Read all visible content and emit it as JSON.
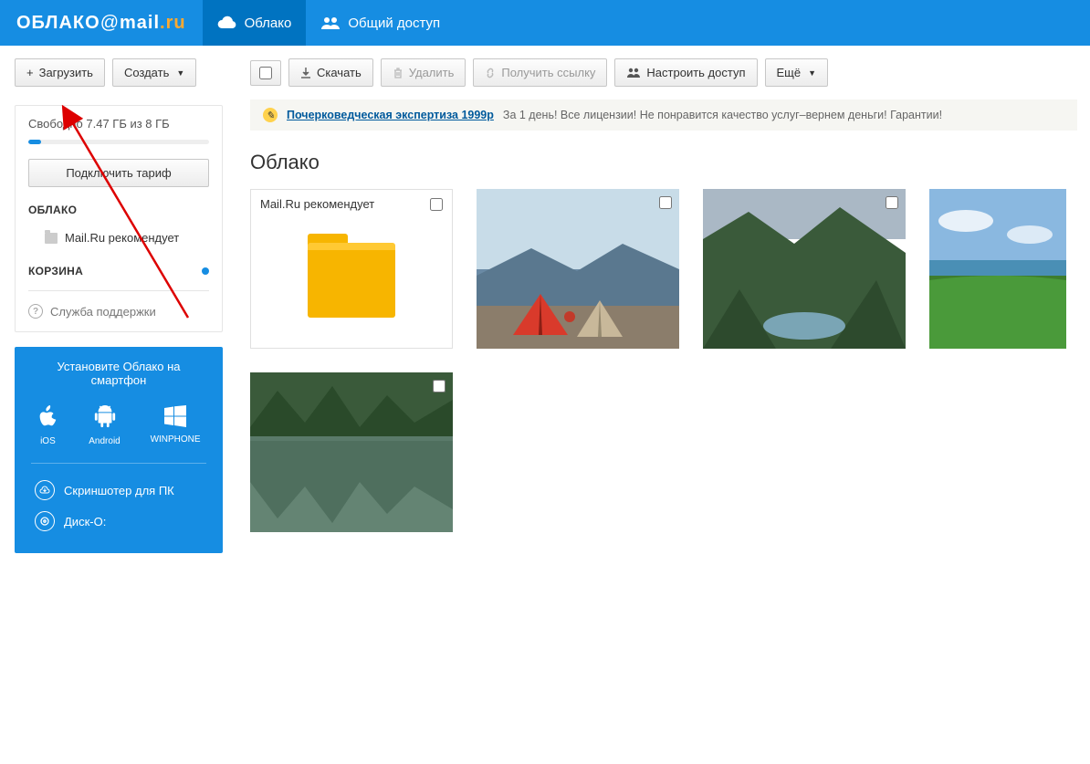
{
  "header": {
    "logo_pre": "ОБЛАКО",
    "logo_at": "@",
    "logo_brand1": "mail",
    "logo_brand2": ".ru",
    "nav": [
      {
        "label": "Облако",
        "active": true
      },
      {
        "label": "Общий доступ",
        "active": false
      }
    ]
  },
  "sidebar": {
    "upload_btn": "Загрузить",
    "create_btn": "Создать",
    "storage_text": "Свободно 7.47 ГБ из 8 ГБ",
    "plan_btn": "Подключить тариф",
    "section_cloud": "ОБЛАКО",
    "cloud_items": [
      {
        "label": "Mail.Ru рекомендует"
      }
    ],
    "section_trash": "КОРЗИНА",
    "support": "Служба поддержки"
  },
  "promo": {
    "title": "Установите Облако на смартфон",
    "apps": [
      {
        "label": "iOS"
      },
      {
        "label": "Android"
      },
      {
        "label": "WINPHONE"
      }
    ],
    "line1": "Скриншотер для ПК",
    "line2": "Диск-О:"
  },
  "toolbar": {
    "download": "Скачать",
    "delete": "Удалить",
    "get_link": "Получить ссылку",
    "access": "Настроить доступ",
    "more": "Ещё"
  },
  "banner": {
    "link": "Почерковедческая экспертиза 1999р",
    "text": "За 1 день! Все лицензии! Не понравится качество услуг–вернем деньги! Гарантии!"
  },
  "page_title": "Облако",
  "tiles": [
    {
      "type": "folder",
      "label": "Mail.Ru рекомендует"
    },
    {
      "type": "image"
    },
    {
      "type": "image"
    },
    {
      "type": "image"
    },
    {
      "type": "image"
    }
  ]
}
